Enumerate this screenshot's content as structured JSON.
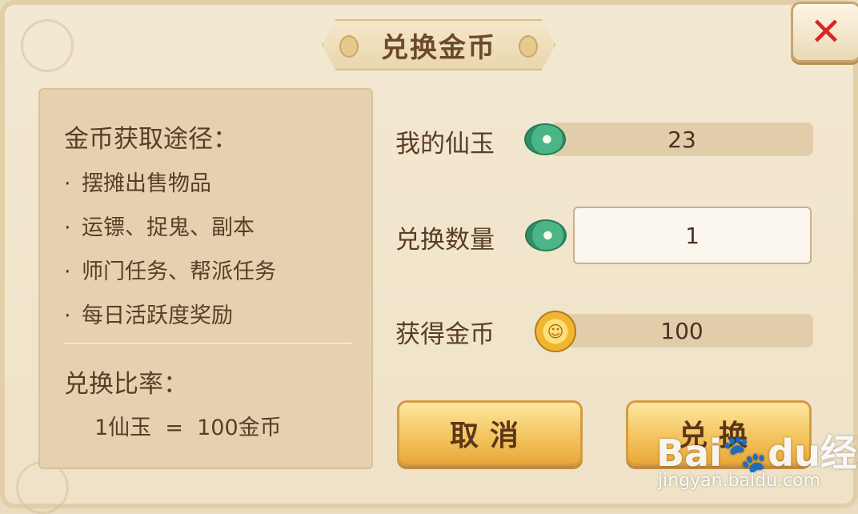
{
  "dialog": {
    "title": "兑换金币",
    "close_icon": "close-x-icon",
    "close_symbol": "✕"
  },
  "info_panel": {
    "heading": "金币获取途径：",
    "bullet": "·",
    "ways": [
      "摆摊出售物品",
      "运镖、捉鬼、副本",
      "师门任务、帮派任务",
      "每日活跃度奖励"
    ],
    "rate_heading": "兑换比率：",
    "rate_text": "1仙玉  =  100金币"
  },
  "exchange": {
    "my_jade_label": "我的仙玉",
    "my_jade_value": "23",
    "amount_label": "兑换数量",
    "amount_value": "1",
    "gold_label": "获得金币",
    "gold_value": "100"
  },
  "buttons": {
    "cancel": "取消",
    "confirm": "兑换"
  },
  "watermark": {
    "logo": "Bai🐾du经验",
    "url": "jingyan.baidu.com"
  },
  "colors": {
    "title_text": "#6b4a2b",
    "close_x": "#d7262a",
    "button": "#f4c560",
    "jade": "#4bb588",
    "coin": "#f0b632"
  }
}
